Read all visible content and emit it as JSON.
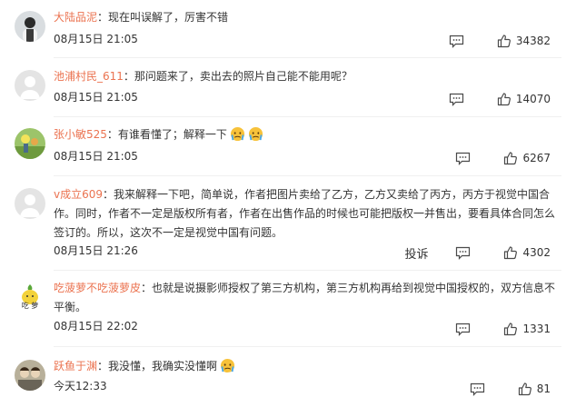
{
  "comments": [
    {
      "user": "大陆品泥",
      "text": "：现在叫误解了，厉害不错",
      "time": "08月15日 21:05",
      "likes": "34382"
    },
    {
      "user": "池浦村民_611",
      "text": "：那问题来了，卖出去的照片自己能不能用呢？",
      "time": "08月15日 21:05",
      "likes": "14070"
    },
    {
      "user": "张小敏525",
      "text": "：有谁看懂了；解释一下",
      "time": "08月15日 21:05",
      "likes": "6267"
    },
    {
      "user": "v成立609",
      "text": "：我来解释一下吧，简单说，作者把图片卖给了乙方，乙方又卖给了丙方，丙方于视觉中国合作。同时，作者不一定是版权所有者，作者在出售作品的时候也可能把版权一并售出，要看具体合同怎么签订的。所以，这次不一定是视觉中国有问题。",
      "time": "08月15日 21:26",
      "likes": "4302",
      "report": "投诉"
    },
    {
      "user": "吃菠萝不吃菠萝皮",
      "text": "：也就是说摄影师授权了第三方机构，第三方机构再给到视觉中国授权的，双方信息不平衡。",
      "time": "08月15日 22:02",
      "likes": "1331"
    },
    {
      "user": "跃鱼于渊",
      "text": "：我没懂，我确实没懂啊",
      "time": "今天12:33",
      "likes": "81"
    }
  ],
  "avatar_texts": {
    "c5": "吃 萝"
  },
  "colors": {
    "username": "#eb7350",
    "text": "#333333",
    "icon": "#4a4a4a"
  },
  "icons": {
    "reply": "comment-icon",
    "like": "thumbs-up-icon",
    "emoji": "crying-face-emoji"
  }
}
